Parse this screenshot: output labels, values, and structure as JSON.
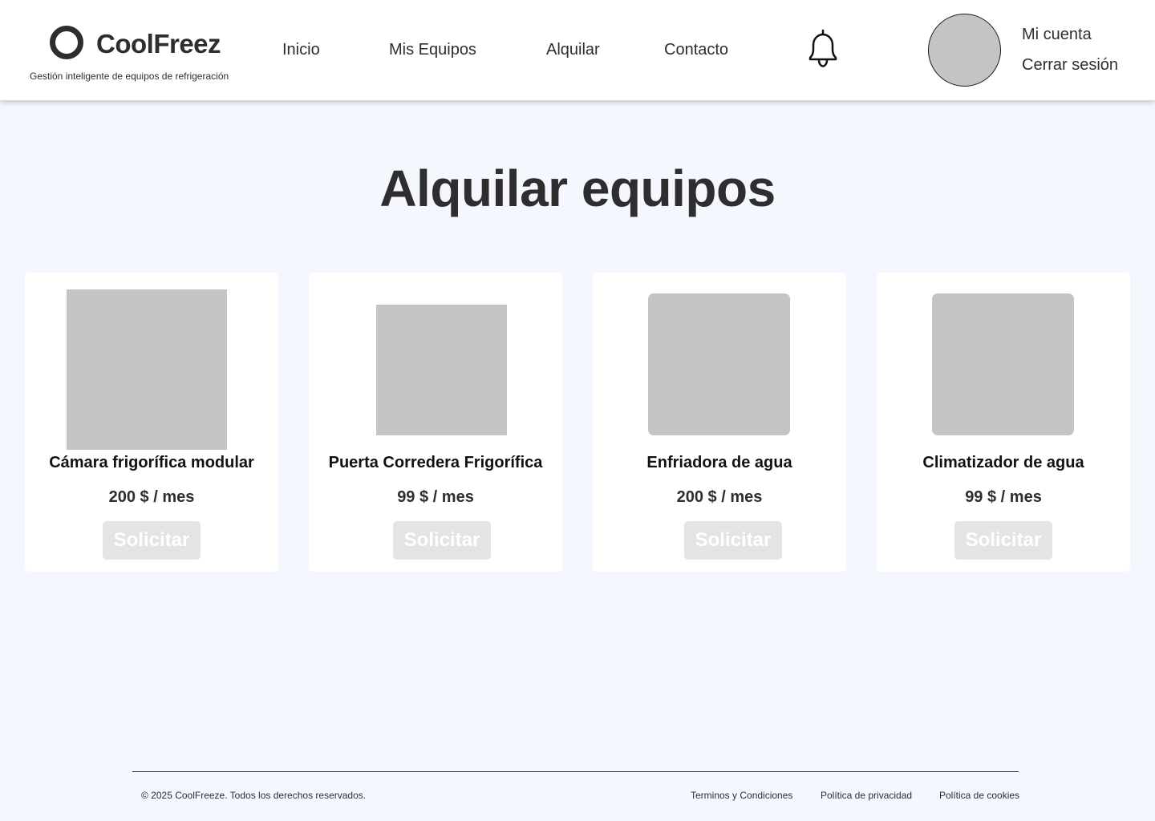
{
  "brand": {
    "name": "CoolFreez",
    "tagline": "Gestión inteligente de equipos de refrigeración",
    "logo_icon": "ring-logo-icon"
  },
  "nav": {
    "items": [
      "Inicio",
      "Mis Equipos",
      "Alquilar",
      "Contacto"
    ],
    "notification_icon": "bell-icon"
  },
  "account": {
    "my_account": "Mi cuenta",
    "logout": "Cerrar sesión"
  },
  "main": {
    "title": "Alquilar equipos",
    "products": [
      {
        "name": "Cámara frigorífica modular",
        "price": "200 $ / mes",
        "button": "Solicitar"
      },
      {
        "name": "Puerta Corredera Frigorífica",
        "price": "99 $ / mes",
        "button": "Solicitar"
      },
      {
        "name": "Enfriadora de agua",
        "price": "200 $ / mes",
        "button": "Solicitar"
      },
      {
        "name": "Climatizador de agua",
        "price": "99 $ / mes",
        "button": "Solicitar"
      }
    ]
  },
  "footer": {
    "copyright": "© 2025 CoolFreeze. Todos los derechos reservados.",
    "links": [
      "Terminos y Condiciones",
      "Política de privacidad",
      "Política de cookies"
    ]
  },
  "colors": {
    "background": "#f4f7fd",
    "header_bg": "#ffffff",
    "text": "#2e2e31",
    "placeholder": "#c4c4c4",
    "button_bg": "#e4e4e4"
  }
}
